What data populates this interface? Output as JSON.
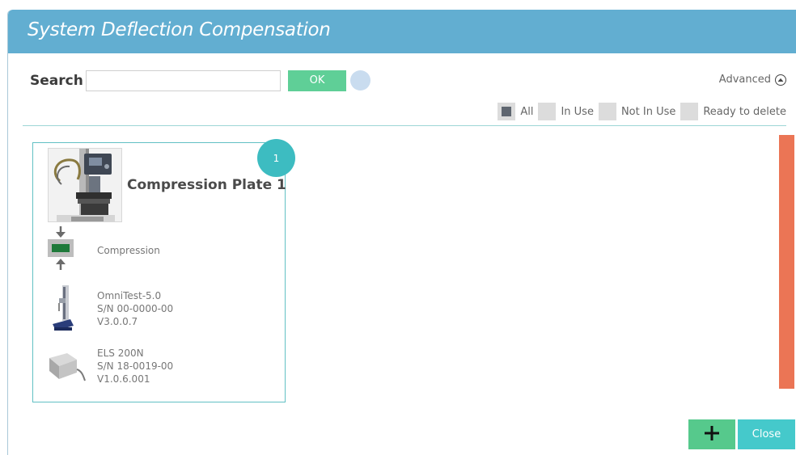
{
  "dialog": {
    "title": "System Deflection Compensation"
  },
  "search": {
    "label": "Search",
    "value": "",
    "placeholder": "",
    "ok_label": "OK"
  },
  "advanced": {
    "label": "Advanced",
    "icon": "chevron-up-circle-icon"
  },
  "filters": [
    {
      "label": "All",
      "checked": true
    },
    {
      "label": "In Use",
      "checked": false
    },
    {
      "label": "Not In Use",
      "checked": false
    },
    {
      "label": "Ready to delete",
      "checked": false
    }
  ],
  "card": {
    "number": "1",
    "title": "Compression Plate 1",
    "test_type": "Compression",
    "stand": {
      "line1": "OmniTest-5.0",
      "line2": "S/N 00-0000-00",
      "line3": "V3.0.0.7"
    },
    "loadcell": {
      "line1": "ELS 200N",
      "line2": "S/N 18-0019-00",
      "line3": "V1.0.6.001"
    }
  },
  "footer": {
    "add_icon": "plus-icon",
    "close_label": "Close"
  },
  "colors": {
    "title_bar": "#62aed1",
    "ok_button": "#5fcf97",
    "card_border": "#62c0c4",
    "badge": "#3dbcc1",
    "side_bar": "#eb7555",
    "add_button": "#56c98c",
    "close_button": "#45c9cb"
  }
}
